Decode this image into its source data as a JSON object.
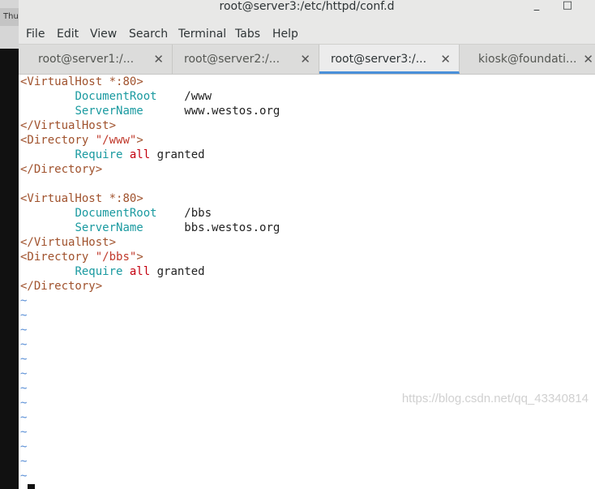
{
  "desktop": {
    "tab_fragment": "Thu"
  },
  "window": {
    "title": "root@server3:/etc/httpd/conf.d",
    "minimize_glyph": "_",
    "maximize_glyph": "□"
  },
  "menu": [
    "File",
    "Edit",
    "View",
    "Search",
    "Terminal",
    "Tabs",
    "Help"
  ],
  "tabs": [
    {
      "label": "root@server1:/...",
      "close": "✕",
      "active": false
    },
    {
      "label": "root@server2:/...",
      "close": "✕",
      "active": false
    },
    {
      "label": "root@server3:/...",
      "close": "✕",
      "active": true
    },
    {
      "label": "kiosk@foundati...",
      "close": "✕",
      "active": false
    }
  ],
  "editor": {
    "lines": [
      {
        "tag_open": "<VirtualHost",
        "attr": " *:80",
        "tag_close": ">"
      },
      {
        "indent": "        ",
        "directive": "DocumentRoot",
        "value": "    /www"
      },
      {
        "indent": "        ",
        "directive": "ServerName",
        "value": "      www.westos.org"
      },
      {
        "tag": "</VirtualHost>"
      },
      {
        "tag_open": "<Directory",
        "string": " \"/www\"",
        "tag_close": ">"
      },
      {
        "indent": "        ",
        "directive": "Require",
        "kw": " all",
        "value": " granted"
      },
      {
        "tag": "</Directory>"
      },
      {
        "blank": ""
      },
      {
        "tag_open": "<VirtualHost",
        "attr": " *:80",
        "tag_close": ">"
      },
      {
        "indent": "        ",
        "directive": "DocumentRoot",
        "value": "    /bbs"
      },
      {
        "indent": "        ",
        "directive": "ServerName",
        "value": "      bbs.westos.org"
      },
      {
        "tag": "</VirtualHost>"
      },
      {
        "tag_open": "<Directory",
        "string": " \"/bbs\"",
        "tag_close": ">"
      },
      {
        "indent": "        ",
        "directive": "Require",
        "kw": " all",
        "value": " granted"
      },
      {
        "tag": "</Directory>"
      }
    ],
    "tilde": "~",
    "tilde_count": 13
  },
  "watermark": "https://blog.csdn.net/qq_43340814",
  "colors": {
    "tag": "#a0522d",
    "directive": "#1a9aa0",
    "keyword": "#c4000f",
    "tilde": "#5a8fd6",
    "active_tab_underline": "#4a90d9"
  }
}
